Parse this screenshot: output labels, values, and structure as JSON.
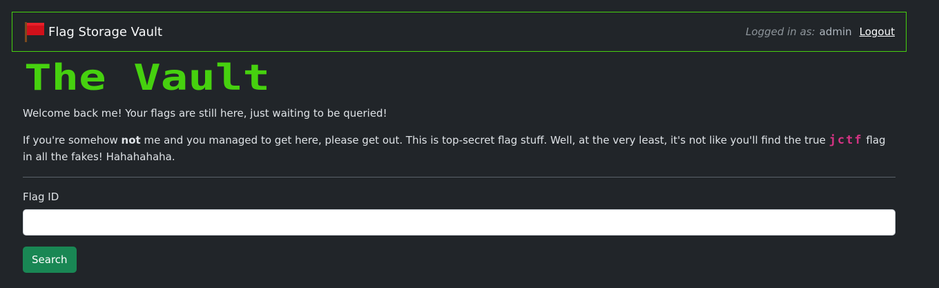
{
  "navbar": {
    "brand_label": "Flag Storage Vault",
    "brand_icon": "red-flag-icon",
    "logged_in_label": "Logged in as:",
    "username": "admin",
    "logout_label": "Logout",
    "border_color": "#46d10f"
  },
  "main": {
    "title": "The Vault",
    "title_color": "#46d10f",
    "welcome_text": "Welcome back me! Your flags are still here, just waiting to be queried!",
    "warning": {
      "part1": "If you're somehow ",
      "emphasis": "not",
      "part2": " me and you managed to get here, please get out. This is top-secret flag stuff. Well, at the very least, it's not like you'll find the true ",
      "code": "jctf",
      "part3": " flag in all the fakes! Hahahahaha."
    }
  },
  "form": {
    "label": "Flag ID",
    "input_value": "",
    "input_placeholder": "",
    "submit_label": "Search",
    "submit_color": "#198754"
  }
}
